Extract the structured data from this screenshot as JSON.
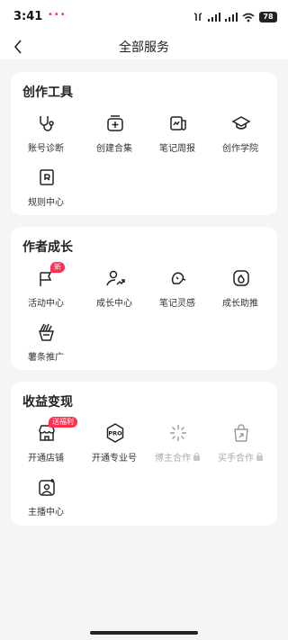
{
  "status_bar": {
    "time": "3:41",
    "notification_dots": "•••",
    "battery": "78"
  },
  "header": {
    "title": "全部服务"
  },
  "sections": {
    "creation_tools": {
      "title": "创作工具",
      "items": [
        {
          "label": "账号诊断",
          "icon": "stethoscope-icon"
        },
        {
          "label": "创建合集",
          "icon": "collection-add-icon"
        },
        {
          "label": "笔记周报",
          "icon": "report-chart-icon"
        },
        {
          "label": "创作学院",
          "icon": "graduation-cap-icon"
        },
        {
          "label": "规则中心",
          "icon": "rule-book-icon"
        }
      ]
    },
    "author_growth": {
      "title": "作者成长",
      "items": [
        {
          "label": "活动中心",
          "icon": "flag-icon",
          "badge": "新"
        },
        {
          "label": "成长中心",
          "icon": "user-growth-icon"
        },
        {
          "label": "笔记灵感",
          "icon": "lightbulb-icon"
        },
        {
          "label": "成长助推",
          "icon": "flame-boost-icon"
        },
        {
          "label": "薯条推广",
          "icon": "fries-promo-icon"
        }
      ]
    },
    "monetization": {
      "title": "收益变现",
      "items": [
        {
          "label": "开通店铺",
          "icon": "shop-icon",
          "badge": "送福利"
        },
        {
          "label": "开通专业号",
          "icon": "pro-account-icon",
          "pro_text": "PRO"
        },
        {
          "label": "博主合作",
          "icon": "sparkle-cooperation-icon",
          "locked": true
        },
        {
          "label": "买手合作",
          "icon": "shopping-bag-icon",
          "locked": true
        },
        {
          "label": "主播中心",
          "icon": "streamer-icon"
        }
      ]
    }
  },
  "colors": {
    "accent": "#ff2f4e",
    "background": "#f5f5f5",
    "card": "#ffffff",
    "disabled": "#aaaaaa"
  }
}
